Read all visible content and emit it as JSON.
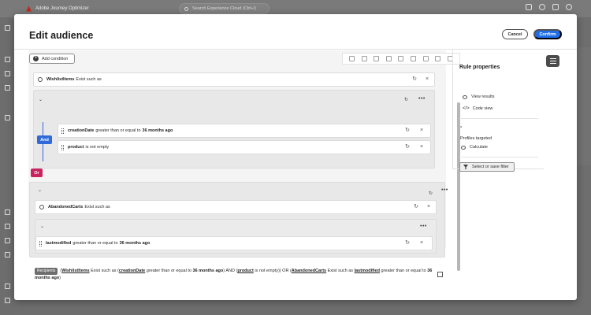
{
  "app": {
    "name": "Adobe Journey Optimizer",
    "search_placeholder": "Search Experience Cloud (Ctrl+/)"
  },
  "modal": {
    "title": "Edit audience",
    "cancel_label": "Cancel",
    "confirm_label": "Confirm"
  },
  "canvas": {
    "add_condition_label": "Add condition",
    "group1": {
      "audience_name": "WishlistItems",
      "audience_suffix": "Exist such as",
      "operator": "And",
      "conditions": [
        {
          "field": "creationDate",
          "op": "greater than or equal to",
          "value": "36 months ago"
        },
        {
          "field": "product",
          "op": "is not empty",
          "value": ""
        }
      ]
    },
    "or_label": "Or",
    "group2": {
      "audience_name": "AbandonedCarts",
      "audience_suffix": "Exist such as",
      "conditions": [
        {
          "field": "lastmodified",
          "op": "greater than or equal to",
          "value": "36 months ago"
        }
      ]
    }
  },
  "summary": {
    "badge": "Recipients",
    "p1": "(",
    "w1": "WishlistItems",
    "t1": " Exist such as (",
    "w2": "creationDate",
    "t2": " greater than or equal to ",
    "v1": "36 months ago",
    "t3": ") AND (",
    "w3": "product",
    "t4": " is not empty)) OR (",
    "w4": "AbandonedCarts",
    "t5": " Exist such as ",
    "w5": "lastmodified",
    "t6": " greater than or equal to ",
    "v2": "36 months ago",
    "t7": ")"
  },
  "rule_panel": {
    "title": "Rule properties",
    "view_results": "View results",
    "code_view": "Code view",
    "count_value": "-",
    "profiles_targeted": "Profiles targeted",
    "calculate": "Calculate",
    "filter_button": "Select or save filter"
  },
  "colors": {
    "accent": "#1f6ee8",
    "and_badge": "#2f6ad8",
    "or_badge": "#c9245f"
  }
}
